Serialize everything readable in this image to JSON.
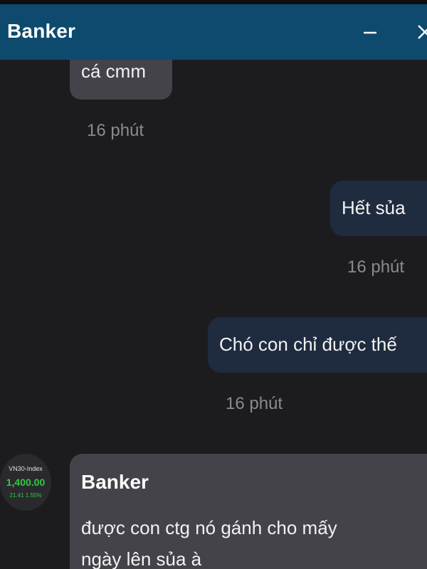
{
  "header": {
    "title": "Banker",
    "minimize_icon": "minimize-icon",
    "close_icon": "close-icon",
    "background": "#0d4a6e"
  },
  "messages": [
    {
      "direction": "incoming",
      "text": "cá cmm",
      "time": "16 phút"
    },
    {
      "direction": "outgoing",
      "text": "Hết sủa",
      "time": "16 phút"
    },
    {
      "direction": "outgoing",
      "text": "Chó con chỉ được thế",
      "time": "16 phút"
    },
    {
      "direction": "incoming",
      "sender": "Banker",
      "text": "được con ctg nó gánh cho mấy ngày lên sủa à",
      "avatar": {
        "name": "VN30-Index",
        "price": "1,400.00",
        "change": "21.41  1.55%"
      }
    }
  ],
  "colors": {
    "incoming_bubble": "#434349",
    "outgoing_bubble": "#1f2b3f",
    "background": "#1c1c1f",
    "price_up": "#2ecc40"
  }
}
